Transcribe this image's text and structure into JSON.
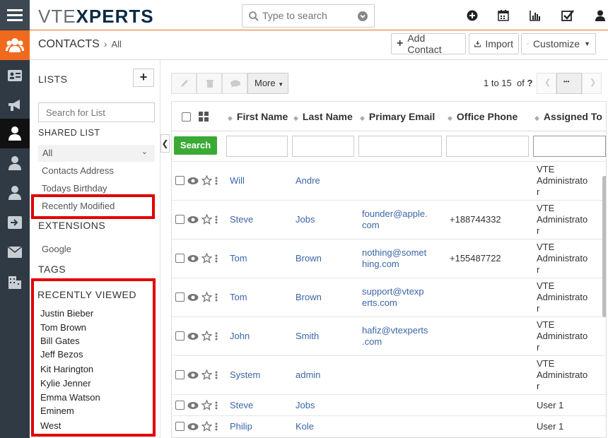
{
  "app": {
    "logo_prefix": "VTE",
    "logo_suffix": "XPERTS"
  },
  "search": {
    "placeholder": "Type to search"
  },
  "header": {
    "module": "CONTACTS",
    "view": "All"
  },
  "actions": {
    "add_contact": "Add Contact",
    "import": "Import",
    "customize": "Customize"
  },
  "sidebar": {
    "lists_title": "LISTS",
    "add_symbol": "+",
    "search_placeholder": "Search for List",
    "shared_title": "SHARED LIST",
    "selected": "All",
    "items": [
      "Contacts Address",
      "Todays Birthday",
      "Recently Modified"
    ],
    "extensions_title": "EXTENSIONS",
    "extensions": [
      "Google"
    ],
    "tags_title": "TAGS",
    "recent_title": "RECENTLY VIEWED",
    "recent": [
      "Justin Bieber",
      "Tom Brown",
      "Bill Gates",
      "Jeff Bezos",
      "Kit Harington",
      "Kylie Jenner",
      "Emma Watson",
      "Eminem",
      "West"
    ]
  },
  "toolbar": {
    "more": "More",
    "pagination": "1 to 15",
    "of_label": "of",
    "total": "?",
    "dots": "•••"
  },
  "table": {
    "columns": [
      "First Name",
      "Last Name",
      "Primary Email",
      "Office Phone",
      "Assigned To"
    ],
    "search_button": "Search",
    "rows": [
      {
        "first": "Will",
        "last": "Andre",
        "email1": "",
        "email2": "",
        "phone": "",
        "assigned": [
          "VTE",
          "Administrato",
          "r"
        ]
      },
      {
        "first": "Steve",
        "last": "Jobs",
        "email1": "founder@apple.",
        "email2": "com",
        "phone": "+188744332",
        "assigned": [
          "VTE",
          "Administrato",
          "r"
        ]
      },
      {
        "first": "Tom",
        "last": "Brown",
        "email1": "nothing@somet",
        "email2": "hing.com",
        "phone": "+155487722",
        "assigned": [
          "VTE",
          "Administrato",
          "r"
        ]
      },
      {
        "first": "Tom",
        "last": "Brown",
        "email1": "support@vtexp",
        "email2": "erts.com",
        "phone": "",
        "assigned": [
          "VTE",
          "Administrato",
          "r"
        ]
      },
      {
        "first": "John",
        "last": "Smith",
        "email1": "hafiz@vtexperts",
        "email2": ".com",
        "phone": "",
        "assigned": [
          "VTE",
          "Administrato",
          "r"
        ]
      },
      {
        "first": "System",
        "last": "admin",
        "email1": "",
        "email2": "",
        "phone": "",
        "assigned": [
          "VTE",
          "Administrato",
          "r"
        ]
      },
      {
        "first": "Steve",
        "last": "Jobs",
        "email1": "",
        "email2": "",
        "phone": "",
        "assigned": [
          "User 1",
          "",
          ""
        ]
      },
      {
        "first": "Philip",
        "last": "Kole",
        "email1": "",
        "email2": "",
        "phone": "",
        "assigned": [
          "User 1",
          "",
          ""
        ]
      }
    ]
  },
  "colors": {
    "accent": "#f06a1e",
    "rail": "#2f3a45",
    "highlight": "#e10000",
    "search_btn": "#3aaa35",
    "link": "#3a66a7"
  }
}
